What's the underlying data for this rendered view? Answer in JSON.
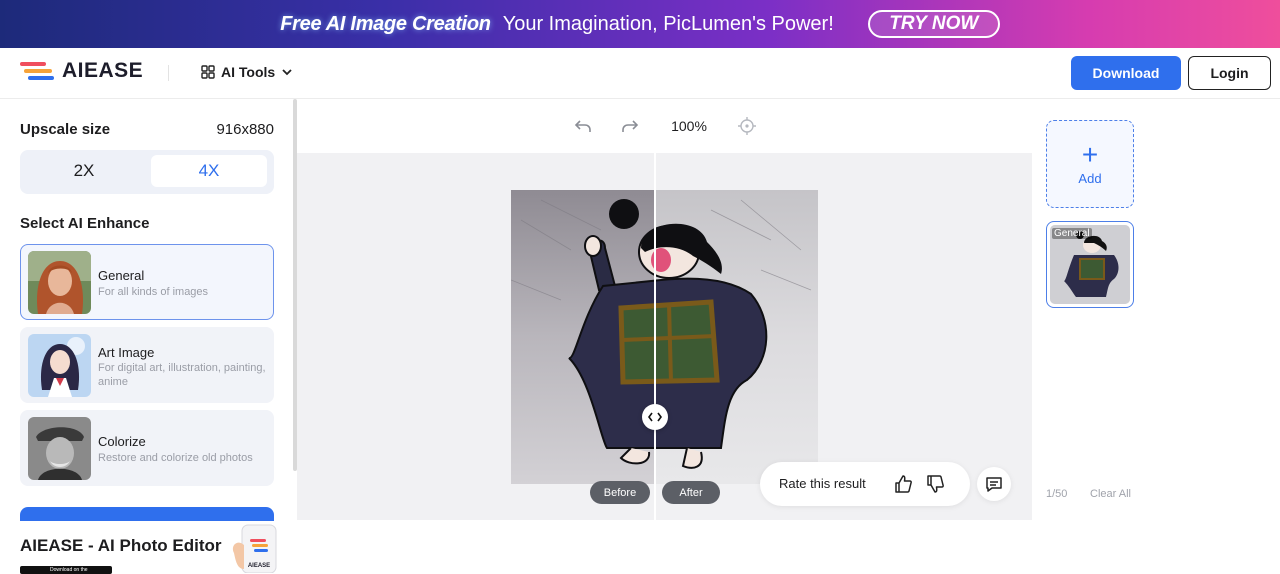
{
  "banner": {
    "headline": "Free AI Image Creation",
    "tagline": "Your Imagination, PicLumen's Power!",
    "cta": "TRY NOW"
  },
  "header": {
    "brand": "AIEASE",
    "tools_label": "AI Tools",
    "download_label": "Download",
    "login_label": "Login",
    "brand_colors": [
      "#f04e5e",
      "#f6a33a",
      "#2f6fed"
    ]
  },
  "left_panel": {
    "upscale_title": "Upscale size",
    "upscale_value": "916x880",
    "scale_options": [
      "2X",
      "4X"
    ],
    "selected_scale": "4X",
    "enhance_title": "Select AI Enhance",
    "modes": [
      {
        "title": "General",
        "desc": "For all kinds of images",
        "selected": true
      },
      {
        "title": "Art Image",
        "desc": "For digital art, illustration, painting, anime",
        "selected": false
      },
      {
        "title": "Colorize",
        "desc": "Restore and colorize old photos",
        "selected": false
      }
    ],
    "app_promo_title": "AIEASE - AI Photo Editor",
    "store_badge": "Download on the",
    "phone_logo": "AIEASE"
  },
  "editor": {
    "zoom": "100%",
    "before_label": "Before",
    "after_label": "After",
    "rate_label": "Rate this result",
    "accent": "#2f6fed"
  },
  "right_panel": {
    "add_label": "Add",
    "thumb_tag": "General",
    "count": "1/50",
    "clear_label": "Clear All"
  }
}
